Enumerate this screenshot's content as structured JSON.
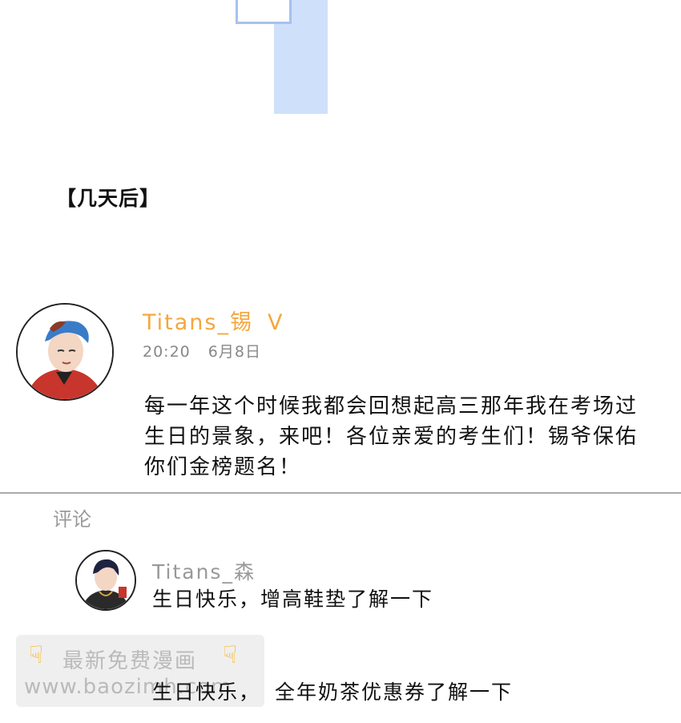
{
  "caption": "【几天后】",
  "post": {
    "username": "Titans_锡",
    "verified_badge": "V",
    "time": "20:20",
    "date": "6月8日",
    "body": "每一年这个时候我都会回想起高三那年我在考场过生日的景象，来吧！各位亲爱的考生们！锡爷保佑你们金榜题名！"
  },
  "comments_section": {
    "label": "评论",
    "items": [
      {
        "username": "Titans_森",
        "text": "生日快乐，增高鞋垫了解一下"
      },
      {
        "username": "",
        "text_prefix": "生日快乐，",
        "text": "全年奶茶优惠券了解一下"
      }
    ]
  },
  "watermark": {
    "line1": "最新免费漫画",
    "line2": "www.baozimh.com"
  },
  "colors": {
    "username_accent": "#f4a73c",
    "panel_blue": "#cfe0fb",
    "muted_text": "#999999"
  }
}
